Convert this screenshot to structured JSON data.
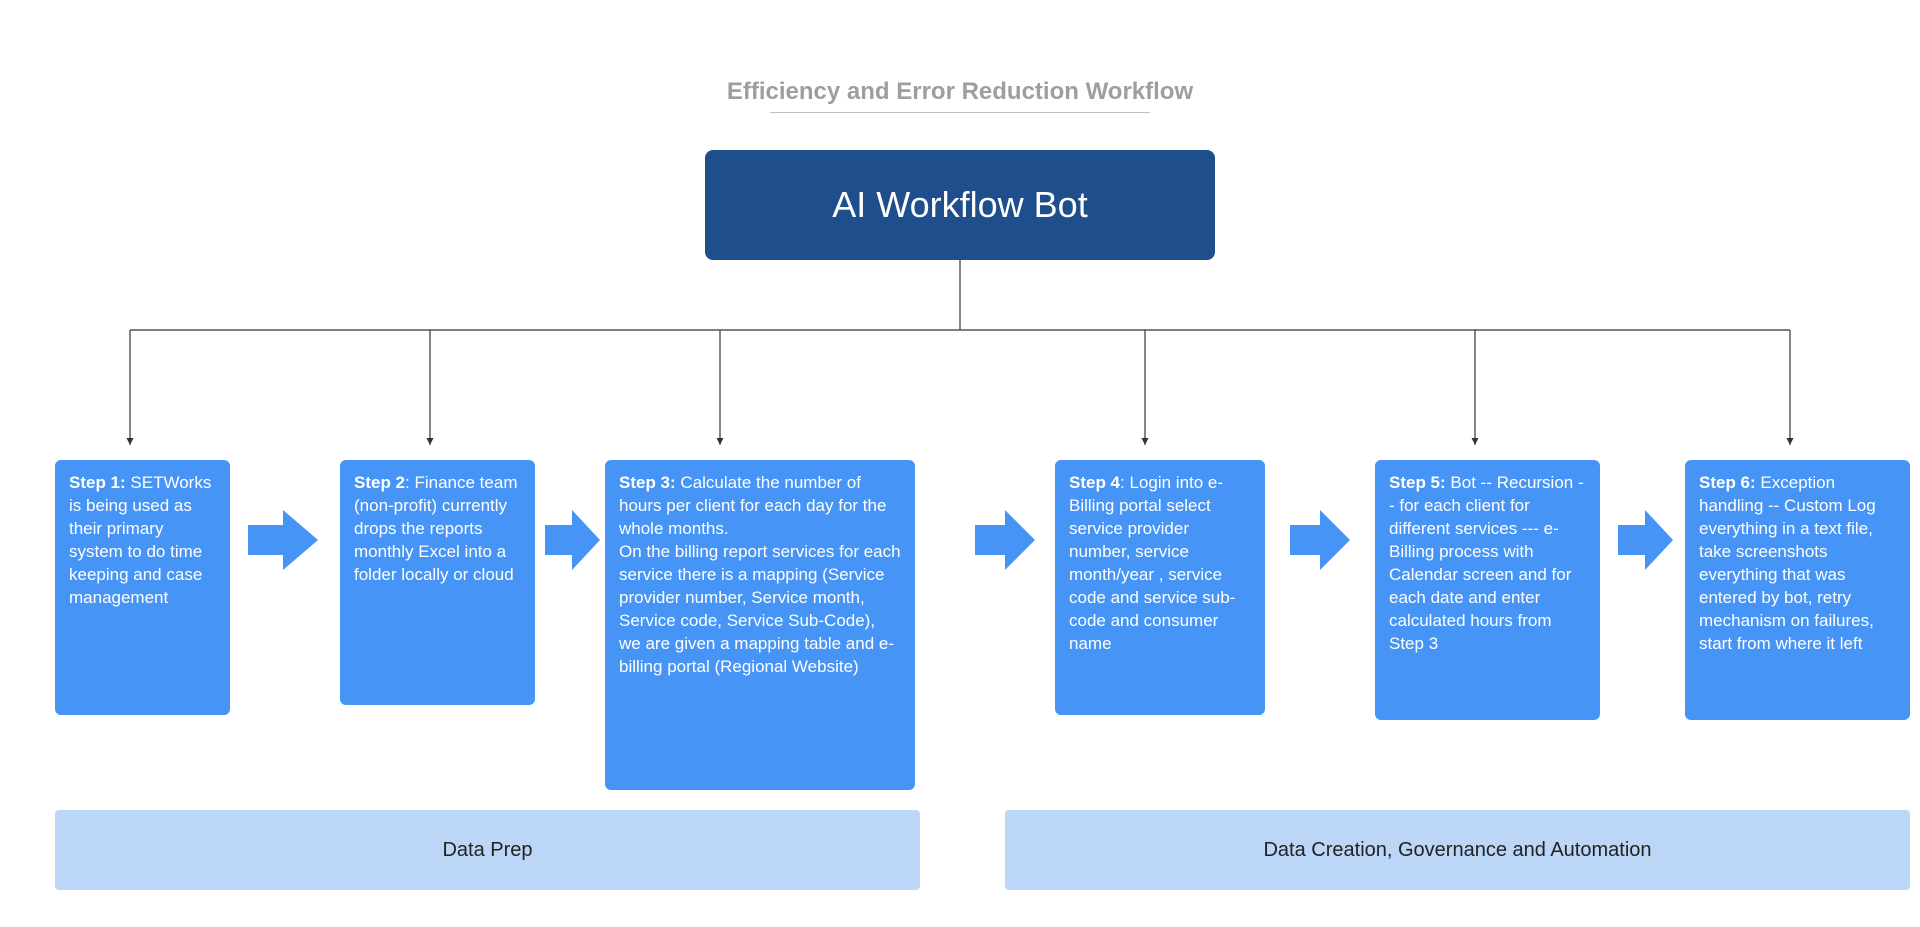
{
  "title": "Efficiency and Error Reduction Workflow",
  "root": "AI Workflow Bot",
  "steps": {
    "s1": {
      "label": "Step 1:",
      "text": "SETWorks is being used as their primary system to do time keeping and case management"
    },
    "s2": {
      "label": "Step 2",
      "text": ": Finance team (non-profit) currently drops the reports monthly Excel into a folder locally or cloud"
    },
    "s3": {
      "label": "Step 3:",
      "text": "Calculate the number of hours per client for each day for the whole months.\nOn the billing report services for each service there is a mapping (Service provider number, Service month, Service code, Service Sub-Code), we are given a mapping table and e-billing portal (Regional Website)"
    },
    "s4": {
      "label": "Step 4",
      "text": ": Login into e-Billing portal select service provider number, service month/year , service code and service sub-code and consumer name"
    },
    "s5": {
      "label": "Step 5:",
      "text": "Bot -- Recursion --  for each client for different services --- e-Billing process with Calendar screen and for each date and enter calculated hours from Step 3"
    },
    "s6": {
      "label": "Step 6:",
      "text": "Exception handling -- Custom Log everything in a text file, take screenshots everything that was entered by bot, retry mechanism on failures, start from where it left"
    }
  },
  "groups": {
    "left": "Data Prep",
    "right": "Data Creation, Governance and Automation"
  }
}
